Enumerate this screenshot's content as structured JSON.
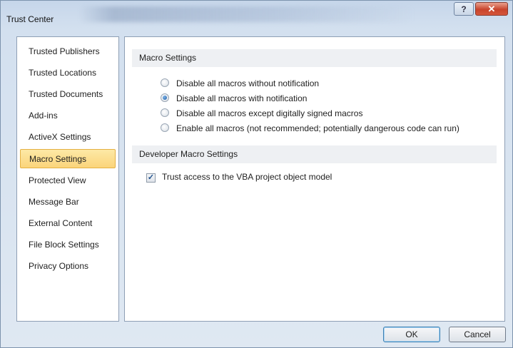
{
  "window": {
    "title": "Trust Center",
    "help_glyph": "?",
    "close_glyph": "✕"
  },
  "nav": {
    "items": [
      {
        "label": "Trusted Publishers",
        "selected": false
      },
      {
        "label": "Trusted Locations",
        "selected": false
      },
      {
        "label": "Trusted Documents",
        "selected": false
      },
      {
        "label": "Add-ins",
        "selected": false
      },
      {
        "label": "ActiveX Settings",
        "selected": false
      },
      {
        "label": "Macro Settings",
        "selected": true
      },
      {
        "label": "Protected View",
        "selected": false
      },
      {
        "label": "Message Bar",
        "selected": false
      },
      {
        "label": "External Content",
        "selected": false
      },
      {
        "label": "File Block Settings",
        "selected": false
      },
      {
        "label": "Privacy Options",
        "selected": false
      }
    ]
  },
  "macro_settings": {
    "header": "Macro Settings",
    "options": [
      {
        "label": "Disable all macros without notification",
        "checked": false
      },
      {
        "label": "Disable all macros with notification",
        "checked": true
      },
      {
        "label": "Disable all macros except digitally signed macros",
        "checked": false
      },
      {
        "label": "Enable all macros (not recommended; potentially dangerous code can run)",
        "checked": false
      }
    ]
  },
  "developer_settings": {
    "header": "Developer Macro Settings",
    "vba_access_label": "Trust access to the VBA project object model",
    "vba_access_checked": true
  },
  "buttons": {
    "ok_label": "OK",
    "cancel_label": "Cancel"
  }
}
